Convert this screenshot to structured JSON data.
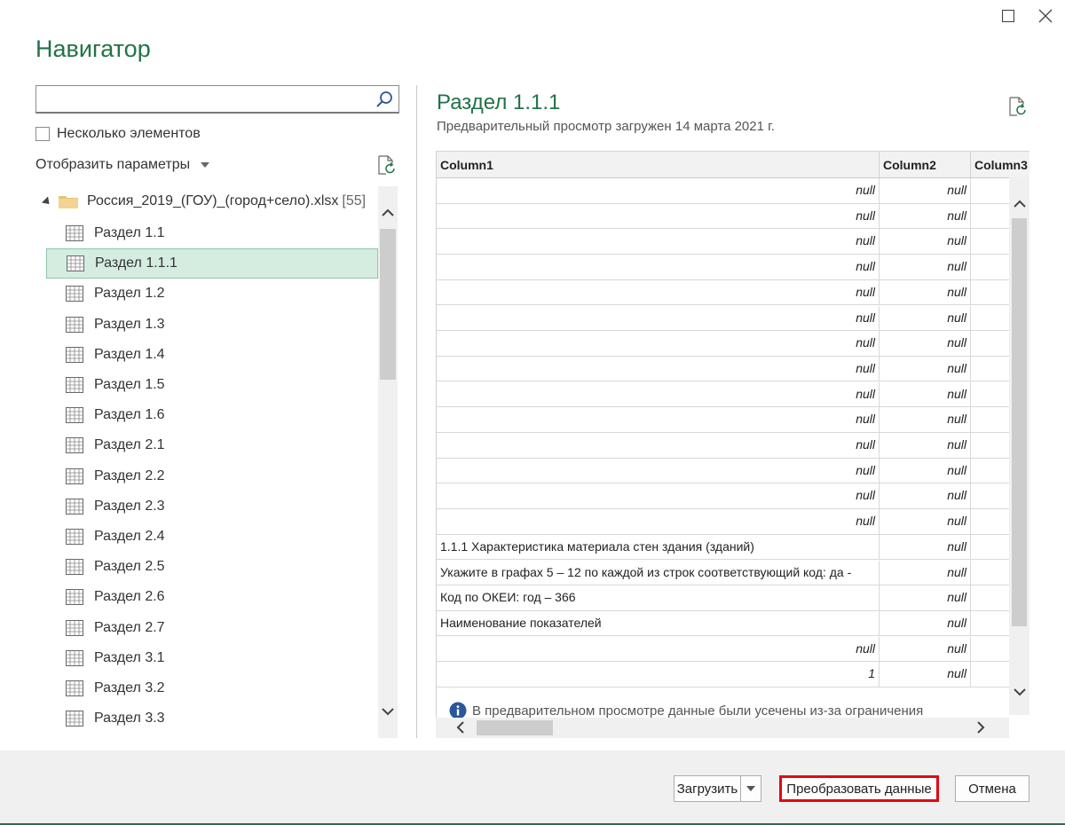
{
  "window": {
    "title": "Навигатор"
  },
  "search": {
    "value": "",
    "placeholder": ""
  },
  "options": {
    "multi_select_label": "Несколько элементов",
    "display_options_label": "Отобразить параметры"
  },
  "tree": {
    "root": {
      "label": "Россия_2019_(ГОУ)_(город+село).xlsx",
      "count": "[55]"
    },
    "items": [
      {
        "label": "Раздел 1.1",
        "selected": false
      },
      {
        "label": "Раздел 1.1.1",
        "selected": true
      },
      {
        "label": "Раздел 1.2",
        "selected": false
      },
      {
        "label": "Раздел 1.3",
        "selected": false
      },
      {
        "label": "Раздел 1.4",
        "selected": false
      },
      {
        "label": "Раздел 1.5",
        "selected": false
      },
      {
        "label": "Раздел 1.6",
        "selected": false
      },
      {
        "label": "Раздел 2.1",
        "selected": false
      },
      {
        "label": "Раздел 2.2",
        "selected": false
      },
      {
        "label": "Раздел 2.3",
        "selected": false
      },
      {
        "label": "Раздел 2.4",
        "selected": false
      },
      {
        "label": "Раздел 2.5",
        "selected": false
      },
      {
        "label": "Раздел 2.6",
        "selected": false
      },
      {
        "label": "Раздел 2.7",
        "selected": false
      },
      {
        "label": "Раздел 3.1",
        "selected": false
      },
      {
        "label": "Раздел 3.2",
        "selected": false
      },
      {
        "label": "Раздел 3.3",
        "selected": false
      }
    ]
  },
  "preview": {
    "title": "Раздел 1.1.1",
    "subtitle": "Предварительный просмотр загружен 14 марта 2021 г.",
    "columns": [
      "Column1",
      "Column2",
      "Column3"
    ],
    "rows": [
      [
        "null",
        "null"
      ],
      [
        "null",
        "null"
      ],
      [
        "null",
        "null"
      ],
      [
        "null",
        "null"
      ],
      [
        "null",
        "null"
      ],
      [
        "null",
        "null"
      ],
      [
        "null",
        "null"
      ],
      [
        "null",
        "null"
      ],
      [
        "null",
        "null"
      ],
      [
        "null",
        "null"
      ],
      [
        "null",
        "null"
      ],
      [
        "null",
        "null"
      ],
      [
        "null",
        "null"
      ],
      [
        "null",
        "null"
      ],
      [
        "1.1.1 Характеристика материала стен здания (зданий)",
        "null"
      ],
      [
        "Укажите в графах 5 – 12 по каждой из строк соответствующий код: да -",
        "null"
      ],
      [
        "Код по ОКЕИ: год – 366",
        "null"
      ],
      [
        "Наименование показателей",
        "null"
      ],
      [
        "null",
        "null"
      ],
      [
        "1",
        "null"
      ]
    ],
    "text_rows": [
      14,
      15,
      16,
      17
    ],
    "info_text": "В предварительном просмотре данные были усечены из-за ограничения"
  },
  "footer": {
    "load_label": "Загрузить",
    "transform_label": "Преобразовать данные",
    "cancel_label": "Отмена"
  },
  "colors": {
    "accent": "#217346",
    "selected_bg": "#d5ede0",
    "highlight_border": "#e30613"
  }
}
